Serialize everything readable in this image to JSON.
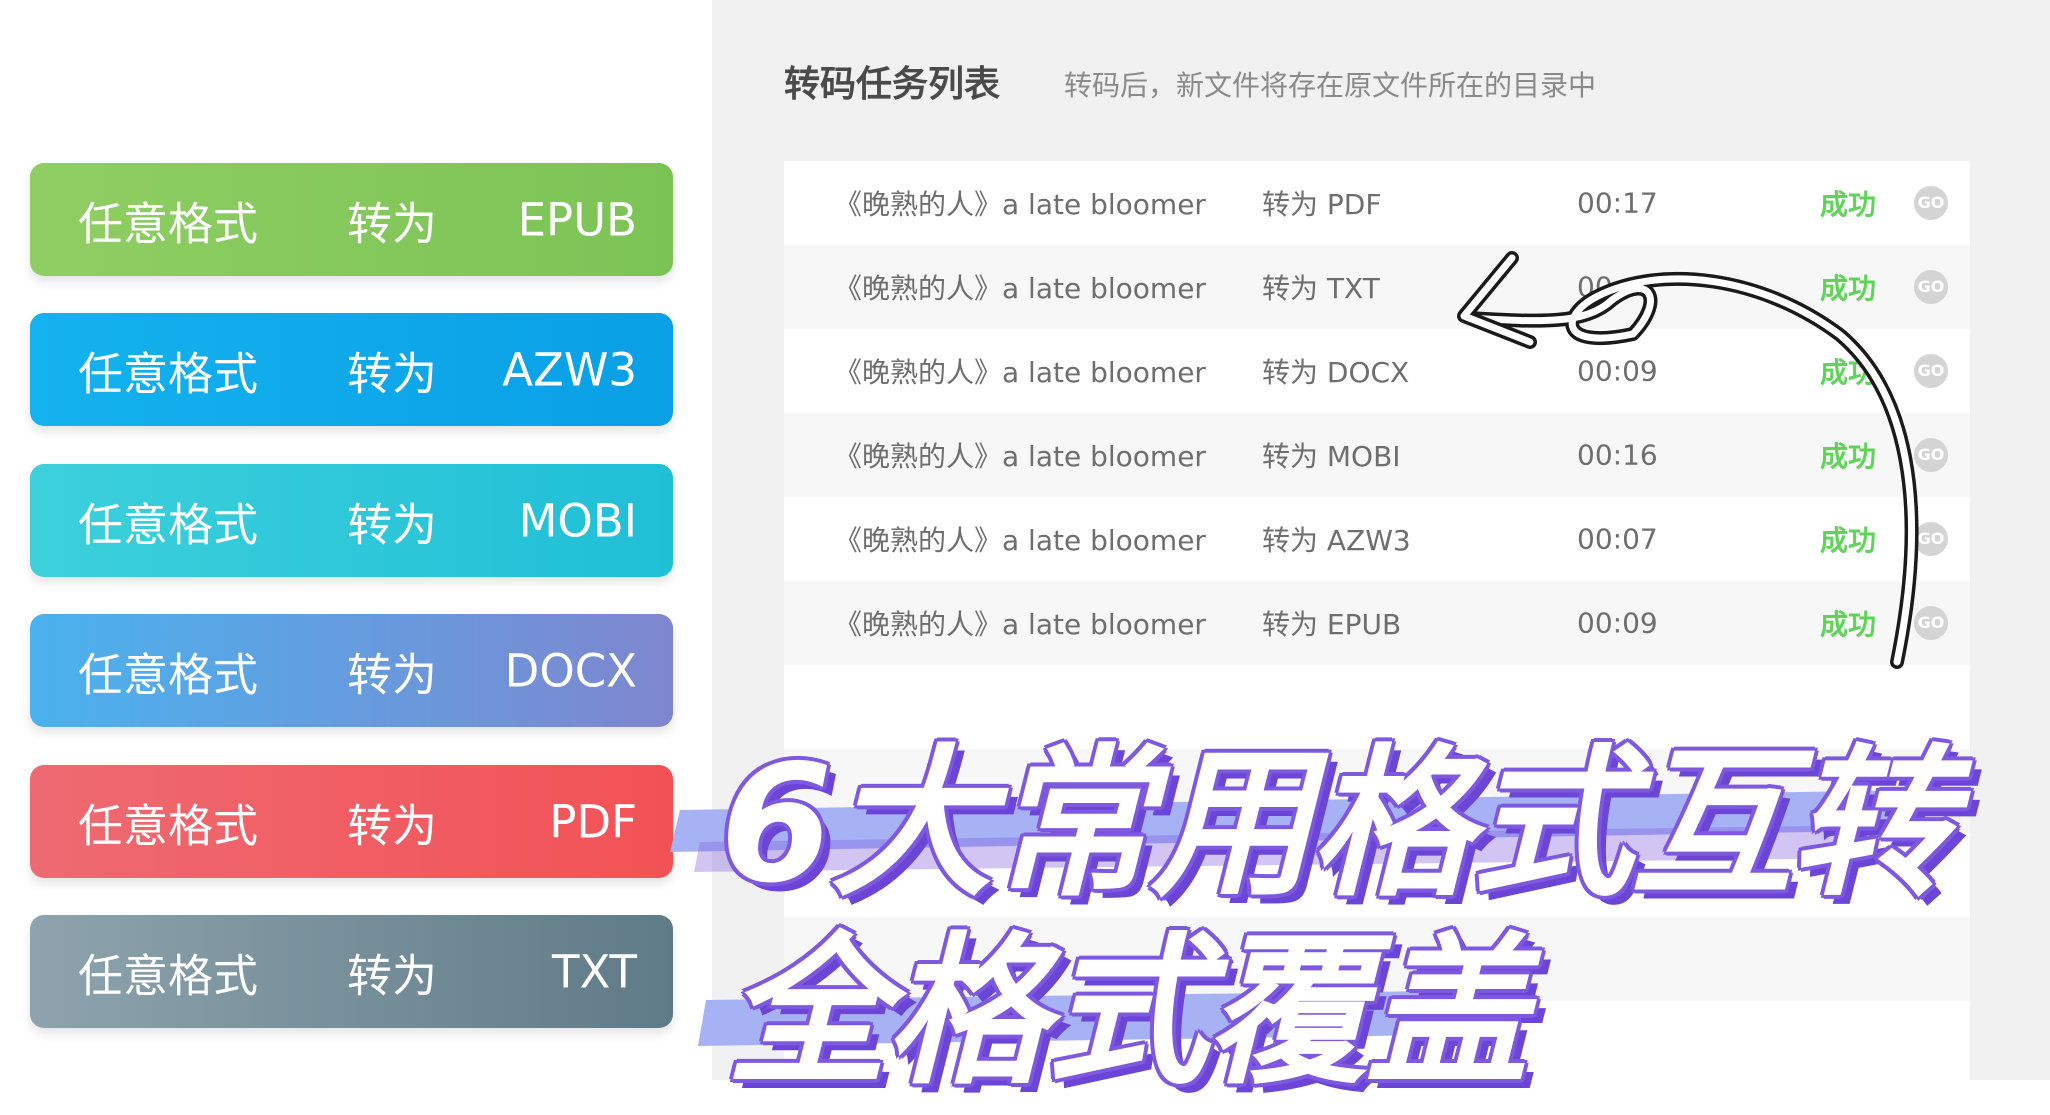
{
  "converters": [
    {
      "any": "任意格式",
      "to": "转为",
      "format": "EPUB",
      "color_start": "#8fce62",
      "color_end": "#7cc356"
    },
    {
      "any": "任意格式",
      "to": "转为",
      "format": "AZW3",
      "color_start": "#14b2ee",
      "color_end": "#0a9fe6"
    },
    {
      "any": "任意格式",
      "to": "转为",
      "format": "MOBI",
      "color_start": "#3dd0dc",
      "color_end": "#1fbfd6"
    },
    {
      "any": "任意格式",
      "to": "转为",
      "format": "DOCX",
      "color_start": "#4ab2ee",
      "color_end": "#7f86cf"
    },
    {
      "any": "任意格式",
      "to": "转为",
      "format": "PDF",
      "color_start": "#ee6a72",
      "color_end": "#f25256"
    },
    {
      "any": "任意格式",
      "to": "转为",
      "format": "TXT",
      "color_start": "#8ea3ad",
      "color_end": "#5f7b87"
    }
  ],
  "panel": {
    "title": "转码任务列表",
    "subtitle": "转码后，新文件将存在原文件所在的目录中"
  },
  "tasks": [
    {
      "name": "《晚熟的人》a late bloomer",
      "conversion": "转为 PDF",
      "time": "00:17",
      "status": "成功",
      "go": "GO"
    },
    {
      "name": "《晚熟的人》a late bloomer",
      "conversion": "转为 TXT",
      "time": "00:",
      "status": "成功",
      "go": "GO"
    },
    {
      "name": "《晚熟的人》a late bloomer",
      "conversion": "转为 DOCX",
      "time": "00:09",
      "status": "成功",
      "go": "GO"
    },
    {
      "name": "《晚熟的人》a late bloomer",
      "conversion": "转为 MOBI",
      "time": "00:16",
      "status": "成功",
      "go": "GO"
    },
    {
      "name": "《晚熟的人》a late bloomer",
      "conversion": "转为 AZW3",
      "time": "00:07",
      "status": "成功",
      "go": "GO"
    },
    {
      "name": "《晚熟的人》a late bloomer",
      "conversion": "转为 EPUB",
      "time": "00:09",
      "status": "成功",
      "go": "GO"
    }
  ],
  "headline": {
    "line1": "6大常用格式互转",
    "line2": "全格式覆盖"
  },
  "colors": {
    "success": "#5fd35a",
    "accent": "#7f58e0"
  }
}
